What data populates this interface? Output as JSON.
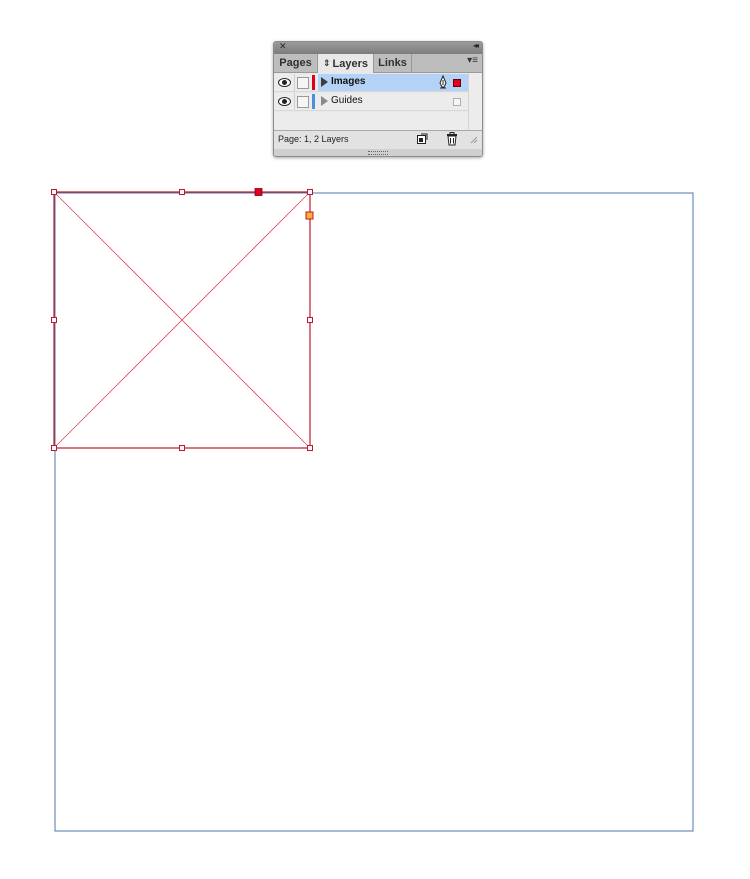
{
  "panel": {
    "tabs": [
      {
        "label": "Pages",
        "active": false
      },
      {
        "label": "Layers",
        "active": true
      },
      {
        "label": "Links",
        "active": false
      }
    ],
    "layers": [
      {
        "name": "Images",
        "color": "#e0001b",
        "selected": true,
        "visible": true
      },
      {
        "name": "Guides",
        "color": "#4a90e2",
        "selected": false,
        "visible": true
      }
    ],
    "status": "Page: 1, 2 Layers"
  },
  "colors": {
    "selection_frame": "#c0172d",
    "page_border": "#4f7aa8",
    "handle_accent": "#e0001b",
    "anchor_yellow": "#f9b233"
  }
}
